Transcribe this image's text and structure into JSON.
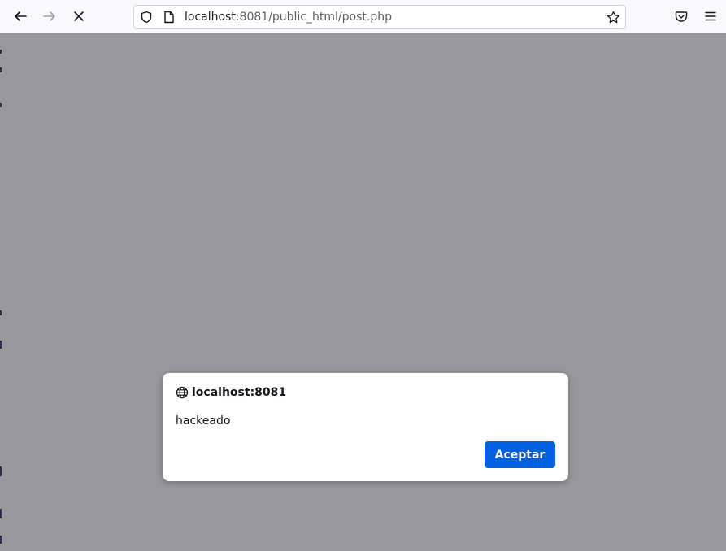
{
  "browser": {
    "url_host": "localhost",
    "url_rest": ":8081/public_html/post.php",
    "icons": {
      "back": "back-arrow-icon",
      "forward": "forward-arrow-icon",
      "stop": "stop-icon",
      "shield": "tracking-shield-icon",
      "page": "page-icon",
      "bookmark": "bookmark-star-icon",
      "pocket": "pocket-icon",
      "menu": "hamburger-menu-icon"
    }
  },
  "dialog": {
    "origin": "localhost:8081",
    "message": "hackeado",
    "ok_label": "Aceptar",
    "globe_icon": "globe-icon"
  },
  "colors": {
    "overlay": "#98989b",
    "button": "#0061e0",
    "toolbar": "#f9f9fb"
  }
}
